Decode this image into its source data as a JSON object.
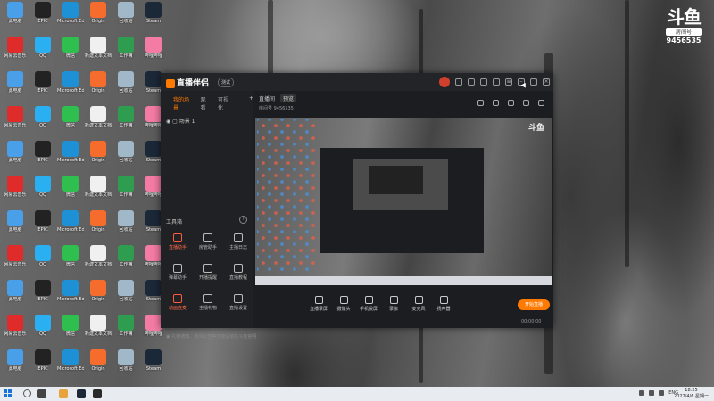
{
  "watermark": {
    "logo": "斗鱼",
    "sub": "房间号",
    "room": "9456535"
  },
  "desktop_icons": [
    {
      "label": "此电脑",
      "color": "#4aa0e8"
    },
    {
      "label": "EPIC",
      "color": "#222222"
    },
    {
      "label": "Microsoft Edge",
      "color": "#1e90d6"
    },
    {
      "label": "Origin",
      "color": "#f56c2d"
    },
    {
      "label": "回收站",
      "color": "#a0b8c8"
    },
    {
      "label": "Steam",
      "color": "#1b2838"
    },
    {
      "label": "网易云音乐",
      "color": "#e02b2b"
    },
    {
      "label": "QQ",
      "color": "#2ab0f0"
    },
    {
      "label": "微信",
      "color": "#2fbf4f"
    },
    {
      "label": "新建文本文档",
      "color": "#f0f0f0"
    },
    {
      "label": "工作簿",
      "color": "#2e9d4f"
    },
    {
      "label": "哔哩哔哩",
      "color": "#f47ba3"
    }
  ],
  "app": {
    "brand": "直播伴侣",
    "version": "测试",
    "left_tabs": [
      "我的场景",
      "观看",
      "可视化"
    ],
    "scene": "场景 1",
    "tools_title": "工具箱",
    "tools": [
      {
        "label": "直播助手",
        "red": true
      },
      {
        "label": "房管助手",
        "red": false
      },
      {
        "label": "主播日志",
        "red": false
      },
      {
        "label": "弹幕助手",
        "red": false
      },
      {
        "label": "开播提醒",
        "red": false
      },
      {
        "label": "直播教程",
        "red": false
      },
      {
        "label": "动画连麦",
        "red": true
      },
      {
        "label": "主播礼物",
        "red": false
      },
      {
        "label": "直播设置",
        "red": false
      }
    ],
    "bottom_note": "礼物通知、房间公告等功能请前往斗鱼官网",
    "right_tabs": [
      "直播间",
      "预览"
    ],
    "room_line": "房间号 9456535",
    "preview_watermark": "斗鱼",
    "controls": [
      {
        "label": "直播录屏"
      },
      {
        "label": "摄像头"
      },
      {
        "label": "手机投屏"
      },
      {
        "label": "录像"
      },
      {
        "label": "麦克风"
      },
      {
        "label": "扬声器"
      }
    ],
    "go_live": "开始直播",
    "timer": "00:00:00"
  },
  "taskbar": {
    "lang": "ENG",
    "time": "18:25",
    "date": "2022/4/6 星期一"
  }
}
